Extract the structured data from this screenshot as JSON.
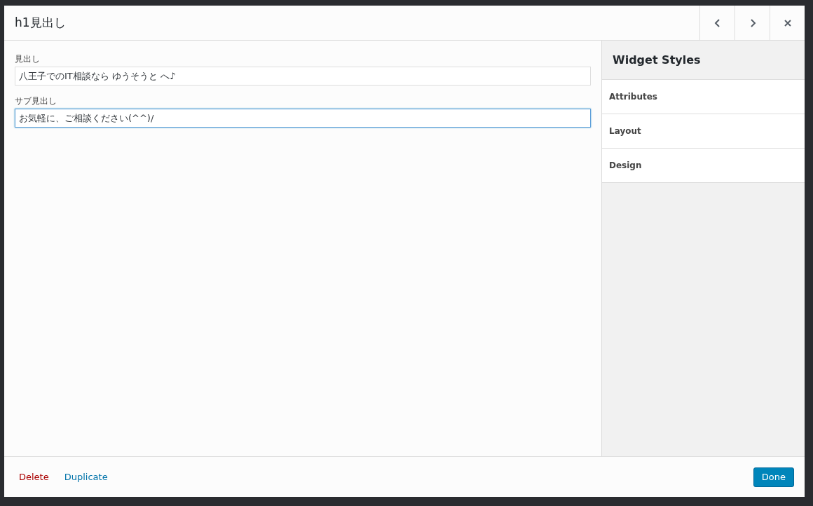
{
  "dialog": {
    "title": "h1見出し"
  },
  "header_buttons": [
    {
      "kind": "prev"
    },
    {
      "kind": "next"
    },
    {
      "kind": "close"
    }
  ],
  "fields": [
    {
      "label": "見出し",
      "value": "八王子でのIT相談なら ゆうそうと へ♪",
      "focused": false
    },
    {
      "label": "サブ見出し",
      "value": "お気軽に、ご相談ください(^^)/",
      "focused": true
    }
  ],
  "sidebar": {
    "title": "Widget Styles",
    "items": [
      "Attributes",
      "Layout",
      "Design"
    ]
  },
  "footer": {
    "links": [
      {
        "label": "Delete",
        "kind": "danger"
      },
      {
        "label": "Duplicate",
        "kind": "normal"
      }
    ],
    "done": "Done"
  }
}
